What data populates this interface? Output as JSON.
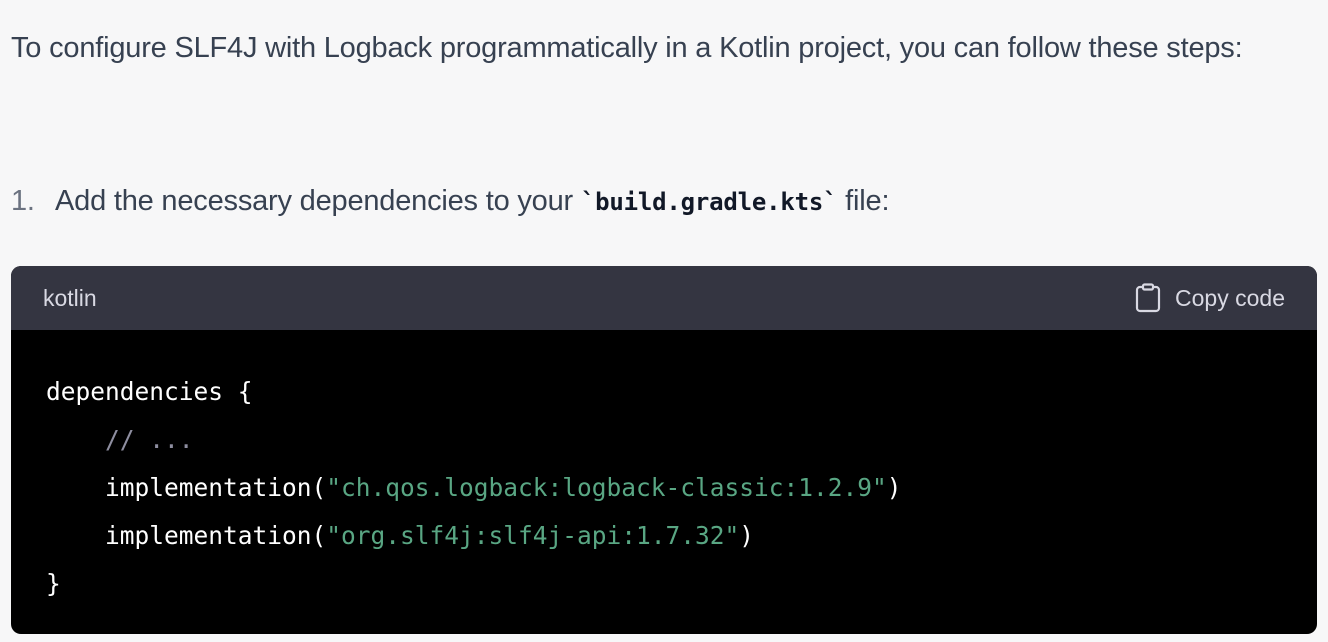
{
  "message": {
    "intro": "To configure SLF4J with Logback programmatically in a Kotlin project, you can follow these steps:",
    "step": {
      "number": "1.",
      "text_before": "Add the necessary dependencies to your ",
      "code": "`build.gradle.kts`",
      "text_after": " file:"
    }
  },
  "code_block": {
    "language": "kotlin",
    "copy_label": "Copy code",
    "copy_icon": "clipboard-icon",
    "lines": {
      "l1": "dependencies {",
      "l2_indent": "    ",
      "l2_comment": "// ...",
      "l3_indent": "    ",
      "l3_call": "implementation(",
      "l3_string": "\"ch.qos.logback:logback-classic:1.2.9\"",
      "l3_close": ")",
      "l4_indent": "    ",
      "l4_call": "implementation(",
      "l4_string": "\"org.slf4j:slf4j-api:1.7.32\"",
      "l4_close": ")",
      "l5": "}"
    },
    "colors": {
      "header_bg": "#343541",
      "body_bg": "#000000",
      "string": "#59a683",
      "comment": "#8e8ea0"
    }
  }
}
